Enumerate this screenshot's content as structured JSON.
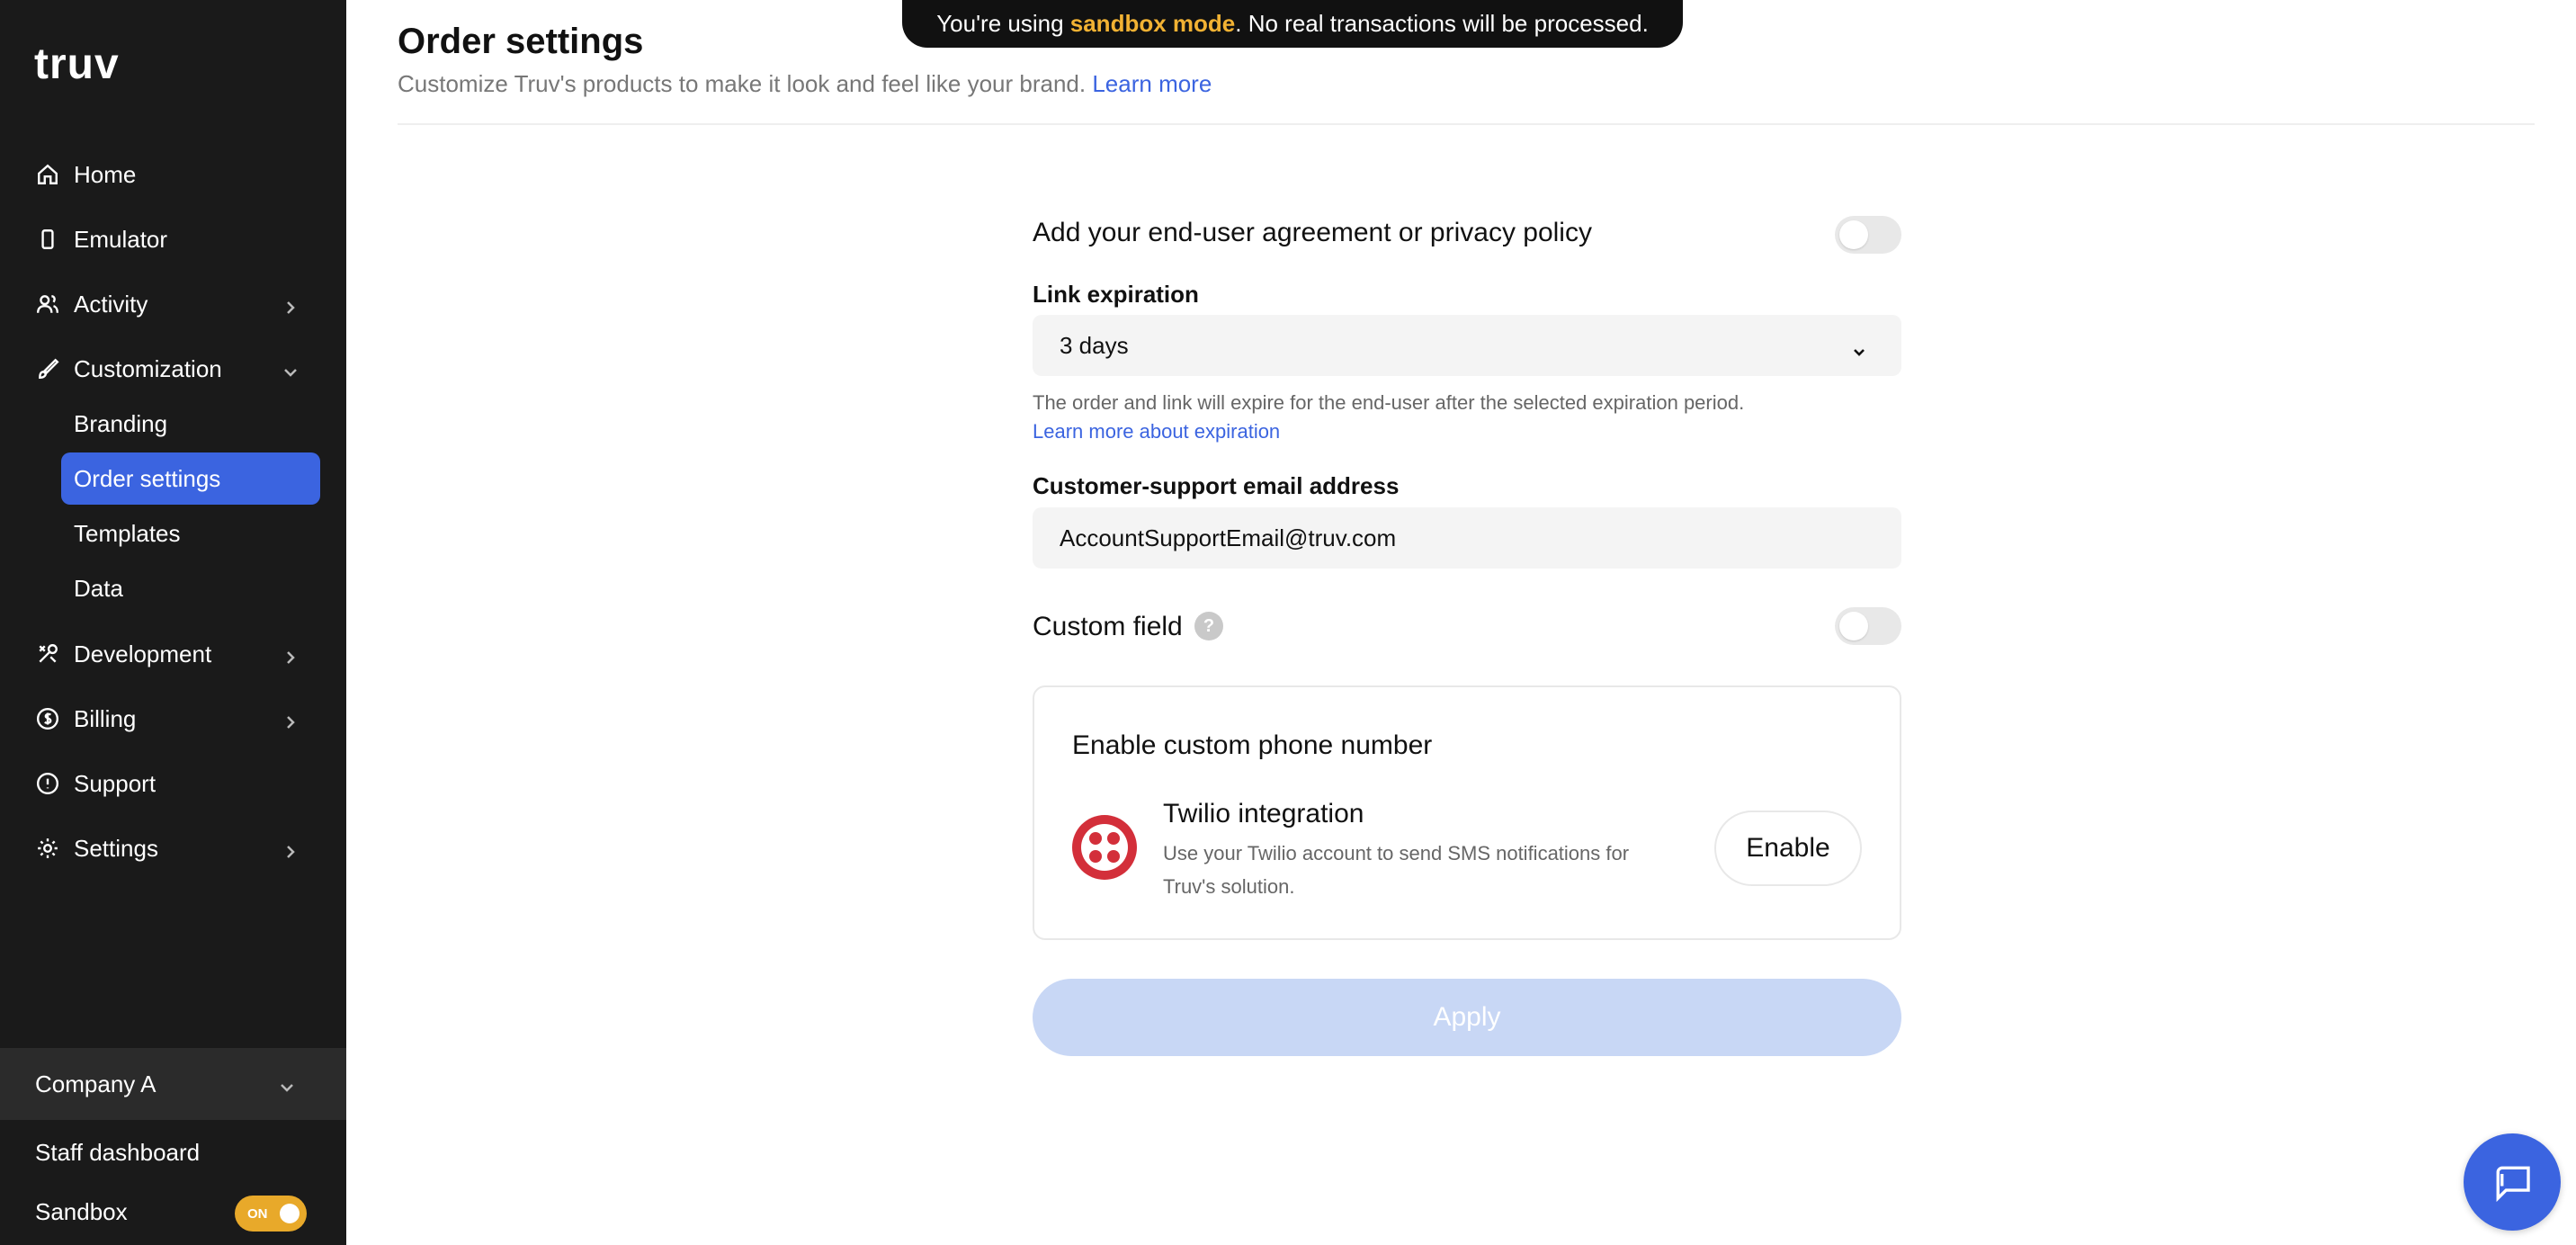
{
  "app": {
    "logo": "truv"
  },
  "banner": {
    "prefix": "You're using ",
    "highlight": "sandbox mode",
    "suffix": ". No real transactions will be processed."
  },
  "sidebar": {
    "items": [
      {
        "label": "Home",
        "icon": "home-icon"
      },
      {
        "label": "Emulator",
        "icon": "device-icon"
      },
      {
        "label": "Activity",
        "icon": "users-icon"
      },
      {
        "label": "Customization",
        "icon": "brush-icon"
      },
      {
        "label": "Development",
        "icon": "tools-icon"
      },
      {
        "label": "Billing",
        "icon": "dollar-icon"
      },
      {
        "label": "Support",
        "icon": "info-icon"
      },
      {
        "label": "Settings",
        "icon": "gear-icon"
      }
    ],
    "sub_items": [
      {
        "label": "Branding"
      },
      {
        "label": "Order settings",
        "active": true
      },
      {
        "label": "Templates"
      },
      {
        "label": "Data"
      }
    ],
    "company": "Company A",
    "staff": "Staff dashboard",
    "sandbox": "Sandbox",
    "sandbox_toggle": "ON"
  },
  "header": {
    "title": "Order settings",
    "subtitle": "Customize Truv's products to make it look and feel like your brand.",
    "learn_more": "Learn more"
  },
  "form": {
    "agreement_label": "Add your end-user agreement or privacy policy",
    "link_expiration_label": "Link expiration",
    "link_expiration_value": "3 days",
    "expiration_help": "The order and link will expire for the end-user after the selected expiration period.",
    "expiration_link": "Learn more about expiration",
    "support_email_label": "Customer-support email address",
    "support_email_value": "AccountSupportEmail@truv.com",
    "custom_field_label": "Custom field",
    "custom_field_help": "?",
    "phone_card_title": "Enable custom phone number",
    "twilio_name": "Twilio integration",
    "twilio_desc": "Use your Twilio account to send SMS notifications for Truv's solution.",
    "enable_label": "Enable",
    "apply_label": "Apply"
  }
}
